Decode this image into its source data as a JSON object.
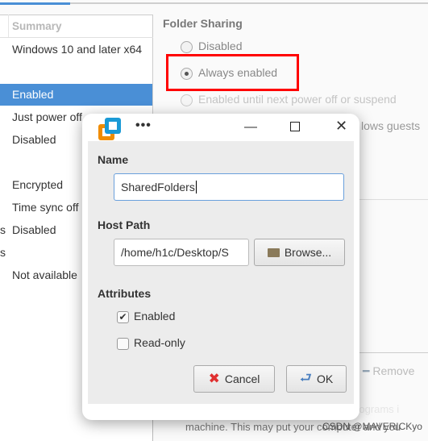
{
  "summary_header": "Summary",
  "summary_rows": [
    "Windows 10 and later x64",
    "Enabled",
    "Just power off",
    "Disabled",
    "Encrypted",
    "Time sync off",
    "Disabled",
    "Not available"
  ],
  "left_edge_fragments": [
    "s",
    "s"
  ],
  "folder_sharing": {
    "title": "Folder Sharing",
    "options": [
      {
        "label": "Disabled",
        "selected": false
      },
      {
        "label": "Always enabled",
        "selected": true
      },
      {
        "label": "Enabled until next power off or suspend",
        "selected": false
      }
    ],
    "partial_text": "lows guests"
  },
  "remove_label": "Remove",
  "warning_text": [
    "Shared folders expose your files to programs i",
    "machine. This may put your computer and you"
  ],
  "watermark": "CSDN @MAVERICKyo",
  "dialog": {
    "title": "•••",
    "name_label": "Name",
    "name_value": "SharedFolders",
    "host_path_label": "Host Path",
    "host_path_value": "/home/h1c/Desktop/S",
    "browse_label": "Browse...",
    "attributes_label": "Attributes",
    "enabled_label": "Enabled",
    "enabled_checked": true,
    "readonly_label": "Read-only",
    "readonly_checked": false,
    "cancel_label": "Cancel",
    "ok_label": "OK"
  },
  "colors": {
    "accent": "#4a8fd6",
    "highlight": "#ff0000",
    "logo_orange": "#f08c00",
    "logo_blue": "#1a9ad6"
  }
}
